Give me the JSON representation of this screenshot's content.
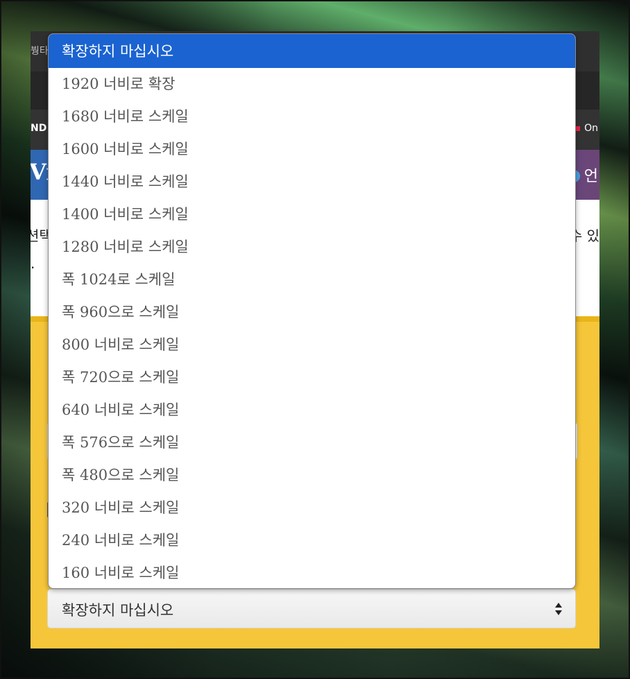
{
  "background_page": {
    "topbar_fragment": "붱타",
    "nav_left": "ND",
    "nav_right": "On",
    "hero_left": "Vi",
    "hero_right": "언",
    "desc_left_line1": "션택",
    "desc_left_line2": ".",
    "desc_right_line1": "수 있"
  },
  "select": {
    "value": "확장하지 마십시오",
    "options": [
      "확장하지 마십시오",
      "1920 너비로 확장",
      "1680 너비로 스케일",
      "1600 너비로 스케일",
      "1440 너비로 스케일",
      "1400 너비로 스케일",
      "1280 너비로 스케일",
      "폭 1024로 스케일",
      "폭 960으로 스케일",
      "800 너비로 스케일",
      "폭 720으로 스케일",
      "640 너비로 스케일",
      "폭 576으로 스케일",
      "폭 480으로 스케일",
      "320 너비로 스케일",
      "240 너비로 스케일",
      "160 너비로 스케일"
    ],
    "selected_index": 0
  },
  "colors": {
    "highlight": "#1a63d1",
    "panel_yellow": "#f6c63a"
  }
}
